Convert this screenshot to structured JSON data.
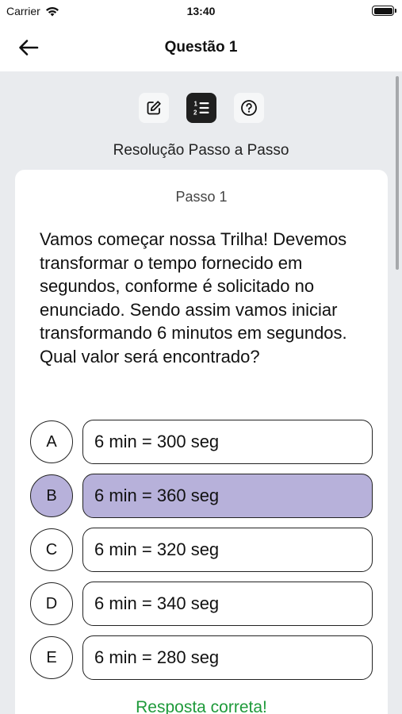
{
  "status_bar": {
    "carrier": "Carrier",
    "time": "13:40"
  },
  "nav": {
    "title": "Questão 1",
    "back_icon": "arrow-left-icon"
  },
  "mode_tabs": [
    {
      "icon": "edit-icon",
      "active": false
    },
    {
      "icon": "numbered-list-icon",
      "active": true
    },
    {
      "icon": "help-icon",
      "active": false
    }
  ],
  "section_title": "Resolução Passo a Passo",
  "card": {
    "step_label": "Passo 1",
    "question": "Vamos começar nossa Trilha! Devemos transformar o tempo fornecido em segundos, conforme é solicitado no enunciado. Sendo assim vamos iniciar transformando 6 minutos em segundos. Qual valor será encontrado?",
    "options": [
      {
        "letter": "A",
        "text": "6 min = 300 seg",
        "selected": false
      },
      {
        "letter": "B",
        "text": "6 min = 360 seg",
        "selected": true
      },
      {
        "letter": "C",
        "text": "6 min = 320 seg",
        "selected": false
      },
      {
        "letter": "D",
        "text": "6 min = 340 seg",
        "selected": false
      },
      {
        "letter": "E",
        "text": "6 min = 280 seg",
        "selected": false
      }
    ],
    "feedback": "Resposta correta!"
  },
  "colors": {
    "selected": "#b7b1da",
    "correct": "#1e9a3a",
    "background": "#e9ebee"
  }
}
